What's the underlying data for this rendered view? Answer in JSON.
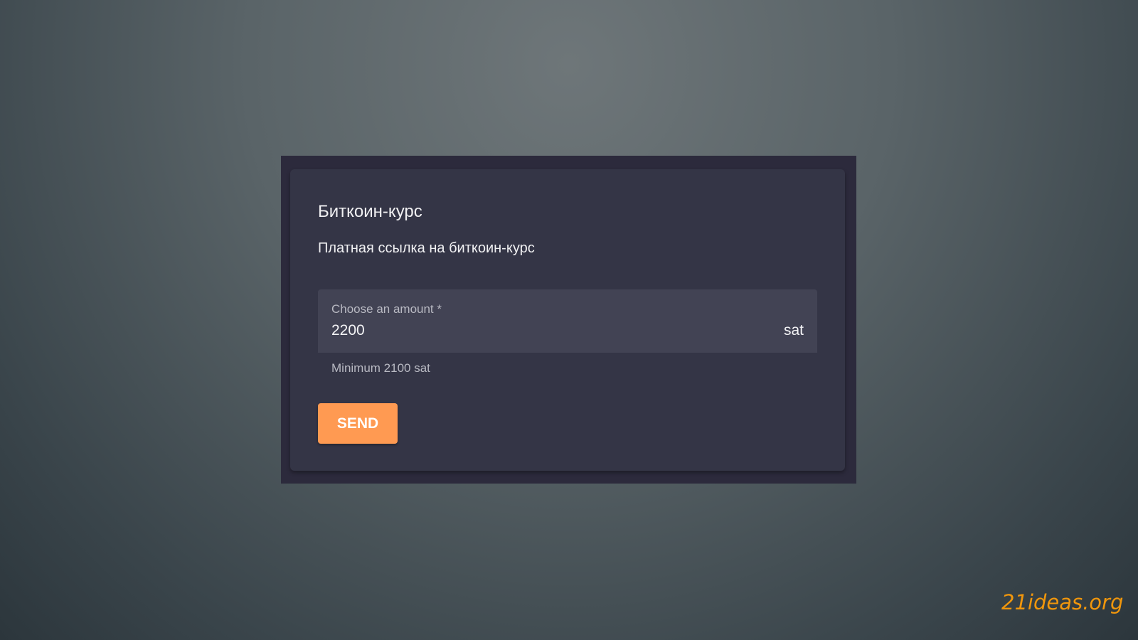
{
  "card": {
    "title": "Биткоин-курс",
    "description": "Платная ссылка на биткоин-курс",
    "amount_field": {
      "label": "Choose an amount *",
      "value": "2200",
      "suffix": "sat",
      "helper": "Minimum 2100 sat"
    },
    "send_label": "SEND"
  },
  "watermark": "21ideas.org",
  "colors": {
    "accent": "#ff9a52",
    "watermark": "#f0960c"
  }
}
